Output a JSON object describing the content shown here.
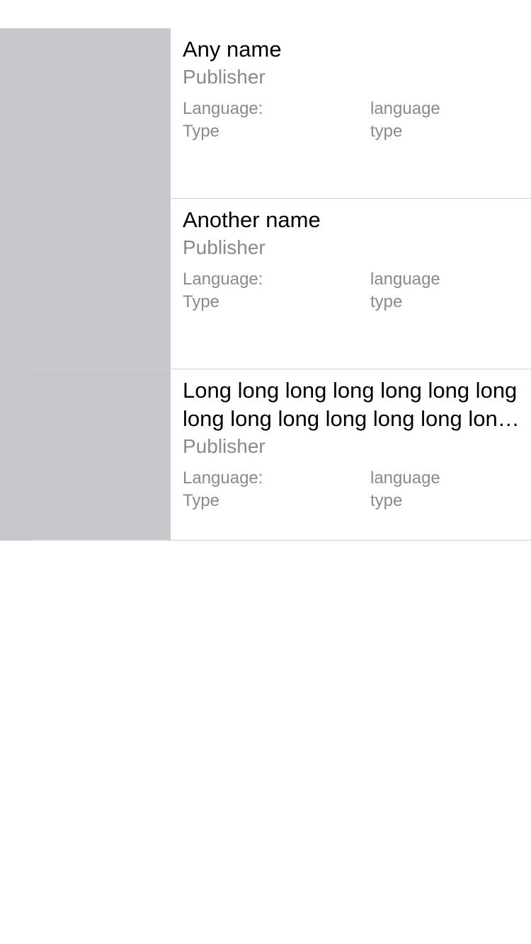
{
  "books": [
    {
      "title": "Any name",
      "publisher": "Publisher",
      "language_label": "Language:",
      "language_value": "language",
      "type_label": "Type",
      "type_value": "type"
    },
    {
      "title": "Another name",
      "publisher": "Publisher",
      "language_label": "Language:",
      "language_value": "language",
      "type_label": "Type",
      "type_value": "type"
    },
    {
      "title": "Long long long long long long long long long long long long long long long long",
      "publisher": "Publisher",
      "language_label": "Language:",
      "language_value": "language",
      "type_label": "Type",
      "type_value": "type"
    }
  ],
  "colors": {
    "cover_placeholder": "#c7c7cc",
    "secondary_text": "#8a8a8e",
    "separator": "#d1d1d6"
  }
}
